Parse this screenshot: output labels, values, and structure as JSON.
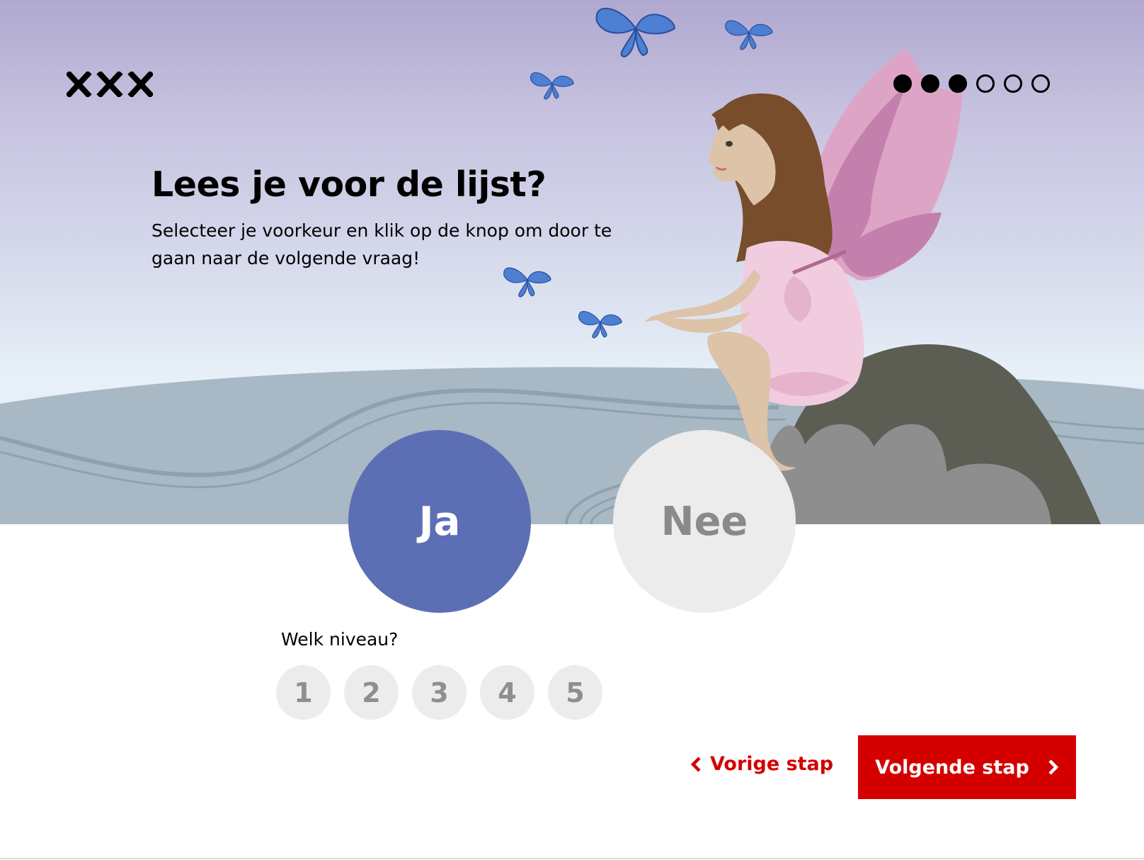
{
  "header": {
    "logo_icon": "three-crosses-logo",
    "progress": {
      "total": 6,
      "completed": 3
    }
  },
  "question": {
    "title": "Lees je voor de lijst?",
    "subtitle": "Selecteer je voorkeur en klik op de knop om door te gaan naar de volgende vraag!"
  },
  "choices": {
    "yes_label": "Ja",
    "no_label": "Nee",
    "selected": "Ja"
  },
  "level": {
    "label": "Welk niveau?",
    "options": [
      "1",
      "2",
      "3",
      "4",
      "5"
    ]
  },
  "navigation": {
    "prev_label": "Vorige stap",
    "next_label": "Volgende stap",
    "prev_icon": "chevron-left-icon",
    "next_icon": "chevron-right-icon"
  },
  "colors": {
    "accent_red": "#d40000",
    "selected_blue": "#5d6fb4",
    "unselected_gray": "#ececec",
    "sky_top": "#b0a8d0",
    "sky_bottom": "#e7f0f8"
  }
}
